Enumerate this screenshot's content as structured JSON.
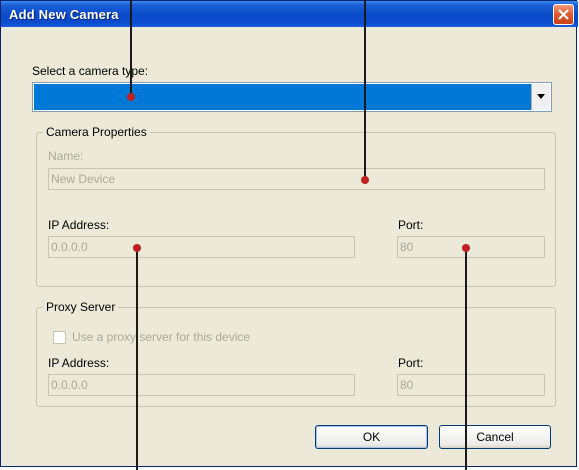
{
  "window": {
    "title": "Add New Camera"
  },
  "camera_type": {
    "label": "Select a camera type:",
    "selected_value": ""
  },
  "camera_properties": {
    "group_title": "Camera Properties",
    "name_label": "Name:",
    "name_value": "New Device",
    "ip_label": "IP Address:",
    "ip_value": "0.0.0.0",
    "port_label": "Port:",
    "port_value": "80"
  },
  "proxy_server": {
    "group_title": "Proxy Server",
    "checkbox_label": "Use a proxy server for this device",
    "checkbox_checked": false,
    "ip_label": "IP Address:",
    "ip_value": "0.0.0.0",
    "port_label": "Port:",
    "port_value": "80"
  },
  "buttons": {
    "ok_label": "OK",
    "cancel_label": "Cancel"
  },
  "colors": {
    "titlebar": "#0b4ac8",
    "selection_highlight": "#0078d7",
    "dialog_background": "#ece9d8",
    "callout_dot": "#c0201e"
  }
}
